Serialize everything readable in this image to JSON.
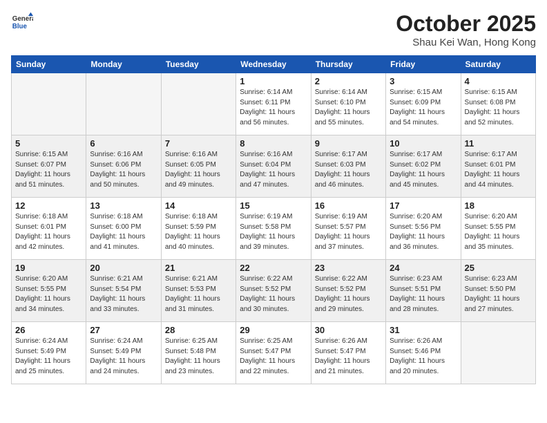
{
  "header": {
    "logo_line1": "General",
    "logo_line2": "Blue",
    "month": "October 2025",
    "location": "Shau Kei Wan, Hong Kong"
  },
  "weekdays": [
    "Sunday",
    "Monday",
    "Tuesday",
    "Wednesday",
    "Thursday",
    "Friday",
    "Saturday"
  ],
  "weeks": [
    [
      {
        "day": "",
        "sunrise": "",
        "sunset": "",
        "daylight": ""
      },
      {
        "day": "",
        "sunrise": "",
        "sunset": "",
        "daylight": ""
      },
      {
        "day": "",
        "sunrise": "",
        "sunset": "",
        "daylight": ""
      },
      {
        "day": "1",
        "sunrise": "Sunrise: 6:14 AM",
        "sunset": "Sunset: 6:11 PM",
        "daylight": "Daylight: 11 hours and 56 minutes."
      },
      {
        "day": "2",
        "sunrise": "Sunrise: 6:14 AM",
        "sunset": "Sunset: 6:10 PM",
        "daylight": "Daylight: 11 hours and 55 minutes."
      },
      {
        "day": "3",
        "sunrise": "Sunrise: 6:15 AM",
        "sunset": "Sunset: 6:09 PM",
        "daylight": "Daylight: 11 hours and 54 minutes."
      },
      {
        "day": "4",
        "sunrise": "Sunrise: 6:15 AM",
        "sunset": "Sunset: 6:08 PM",
        "daylight": "Daylight: 11 hours and 52 minutes."
      }
    ],
    [
      {
        "day": "5",
        "sunrise": "Sunrise: 6:15 AM",
        "sunset": "Sunset: 6:07 PM",
        "daylight": "Daylight: 11 hours and 51 minutes."
      },
      {
        "day": "6",
        "sunrise": "Sunrise: 6:16 AM",
        "sunset": "Sunset: 6:06 PM",
        "daylight": "Daylight: 11 hours and 50 minutes."
      },
      {
        "day": "7",
        "sunrise": "Sunrise: 6:16 AM",
        "sunset": "Sunset: 6:05 PM",
        "daylight": "Daylight: 11 hours and 49 minutes."
      },
      {
        "day": "8",
        "sunrise": "Sunrise: 6:16 AM",
        "sunset": "Sunset: 6:04 PM",
        "daylight": "Daylight: 11 hours and 47 minutes."
      },
      {
        "day": "9",
        "sunrise": "Sunrise: 6:17 AM",
        "sunset": "Sunset: 6:03 PM",
        "daylight": "Daylight: 11 hours and 46 minutes."
      },
      {
        "day": "10",
        "sunrise": "Sunrise: 6:17 AM",
        "sunset": "Sunset: 6:02 PM",
        "daylight": "Daylight: 11 hours and 45 minutes."
      },
      {
        "day": "11",
        "sunrise": "Sunrise: 6:17 AM",
        "sunset": "Sunset: 6:01 PM",
        "daylight": "Daylight: 11 hours and 44 minutes."
      }
    ],
    [
      {
        "day": "12",
        "sunrise": "Sunrise: 6:18 AM",
        "sunset": "Sunset: 6:01 PM",
        "daylight": "Daylight: 11 hours and 42 minutes."
      },
      {
        "day": "13",
        "sunrise": "Sunrise: 6:18 AM",
        "sunset": "Sunset: 6:00 PM",
        "daylight": "Daylight: 11 hours and 41 minutes."
      },
      {
        "day": "14",
        "sunrise": "Sunrise: 6:18 AM",
        "sunset": "Sunset: 5:59 PM",
        "daylight": "Daylight: 11 hours and 40 minutes."
      },
      {
        "day": "15",
        "sunrise": "Sunrise: 6:19 AM",
        "sunset": "Sunset: 5:58 PM",
        "daylight": "Daylight: 11 hours and 39 minutes."
      },
      {
        "day": "16",
        "sunrise": "Sunrise: 6:19 AM",
        "sunset": "Sunset: 5:57 PM",
        "daylight": "Daylight: 11 hours and 37 minutes."
      },
      {
        "day": "17",
        "sunrise": "Sunrise: 6:20 AM",
        "sunset": "Sunset: 5:56 PM",
        "daylight": "Daylight: 11 hours and 36 minutes."
      },
      {
        "day": "18",
        "sunrise": "Sunrise: 6:20 AM",
        "sunset": "Sunset: 5:55 PM",
        "daylight": "Daylight: 11 hours and 35 minutes."
      }
    ],
    [
      {
        "day": "19",
        "sunrise": "Sunrise: 6:20 AM",
        "sunset": "Sunset: 5:55 PM",
        "daylight": "Daylight: 11 hours and 34 minutes."
      },
      {
        "day": "20",
        "sunrise": "Sunrise: 6:21 AM",
        "sunset": "Sunset: 5:54 PM",
        "daylight": "Daylight: 11 hours and 33 minutes."
      },
      {
        "day": "21",
        "sunrise": "Sunrise: 6:21 AM",
        "sunset": "Sunset: 5:53 PM",
        "daylight": "Daylight: 11 hours and 31 minutes."
      },
      {
        "day": "22",
        "sunrise": "Sunrise: 6:22 AM",
        "sunset": "Sunset: 5:52 PM",
        "daylight": "Daylight: 11 hours and 30 minutes."
      },
      {
        "day": "23",
        "sunrise": "Sunrise: 6:22 AM",
        "sunset": "Sunset: 5:52 PM",
        "daylight": "Daylight: 11 hours and 29 minutes."
      },
      {
        "day": "24",
        "sunrise": "Sunrise: 6:23 AM",
        "sunset": "Sunset: 5:51 PM",
        "daylight": "Daylight: 11 hours and 28 minutes."
      },
      {
        "day": "25",
        "sunrise": "Sunrise: 6:23 AM",
        "sunset": "Sunset: 5:50 PM",
        "daylight": "Daylight: 11 hours and 27 minutes."
      }
    ],
    [
      {
        "day": "26",
        "sunrise": "Sunrise: 6:24 AM",
        "sunset": "Sunset: 5:49 PM",
        "daylight": "Daylight: 11 hours and 25 minutes."
      },
      {
        "day": "27",
        "sunrise": "Sunrise: 6:24 AM",
        "sunset": "Sunset: 5:49 PM",
        "daylight": "Daylight: 11 hours and 24 minutes."
      },
      {
        "day": "28",
        "sunrise": "Sunrise: 6:25 AM",
        "sunset": "Sunset: 5:48 PM",
        "daylight": "Daylight: 11 hours and 23 minutes."
      },
      {
        "day": "29",
        "sunrise": "Sunrise: 6:25 AM",
        "sunset": "Sunset: 5:47 PM",
        "daylight": "Daylight: 11 hours and 22 minutes."
      },
      {
        "day": "30",
        "sunrise": "Sunrise: 6:26 AM",
        "sunset": "Sunset: 5:47 PM",
        "daylight": "Daylight: 11 hours and 21 minutes."
      },
      {
        "day": "31",
        "sunrise": "Sunrise: 6:26 AM",
        "sunset": "Sunset: 5:46 PM",
        "daylight": "Daylight: 11 hours and 20 minutes."
      },
      {
        "day": "",
        "sunrise": "",
        "sunset": "",
        "daylight": ""
      }
    ]
  ]
}
